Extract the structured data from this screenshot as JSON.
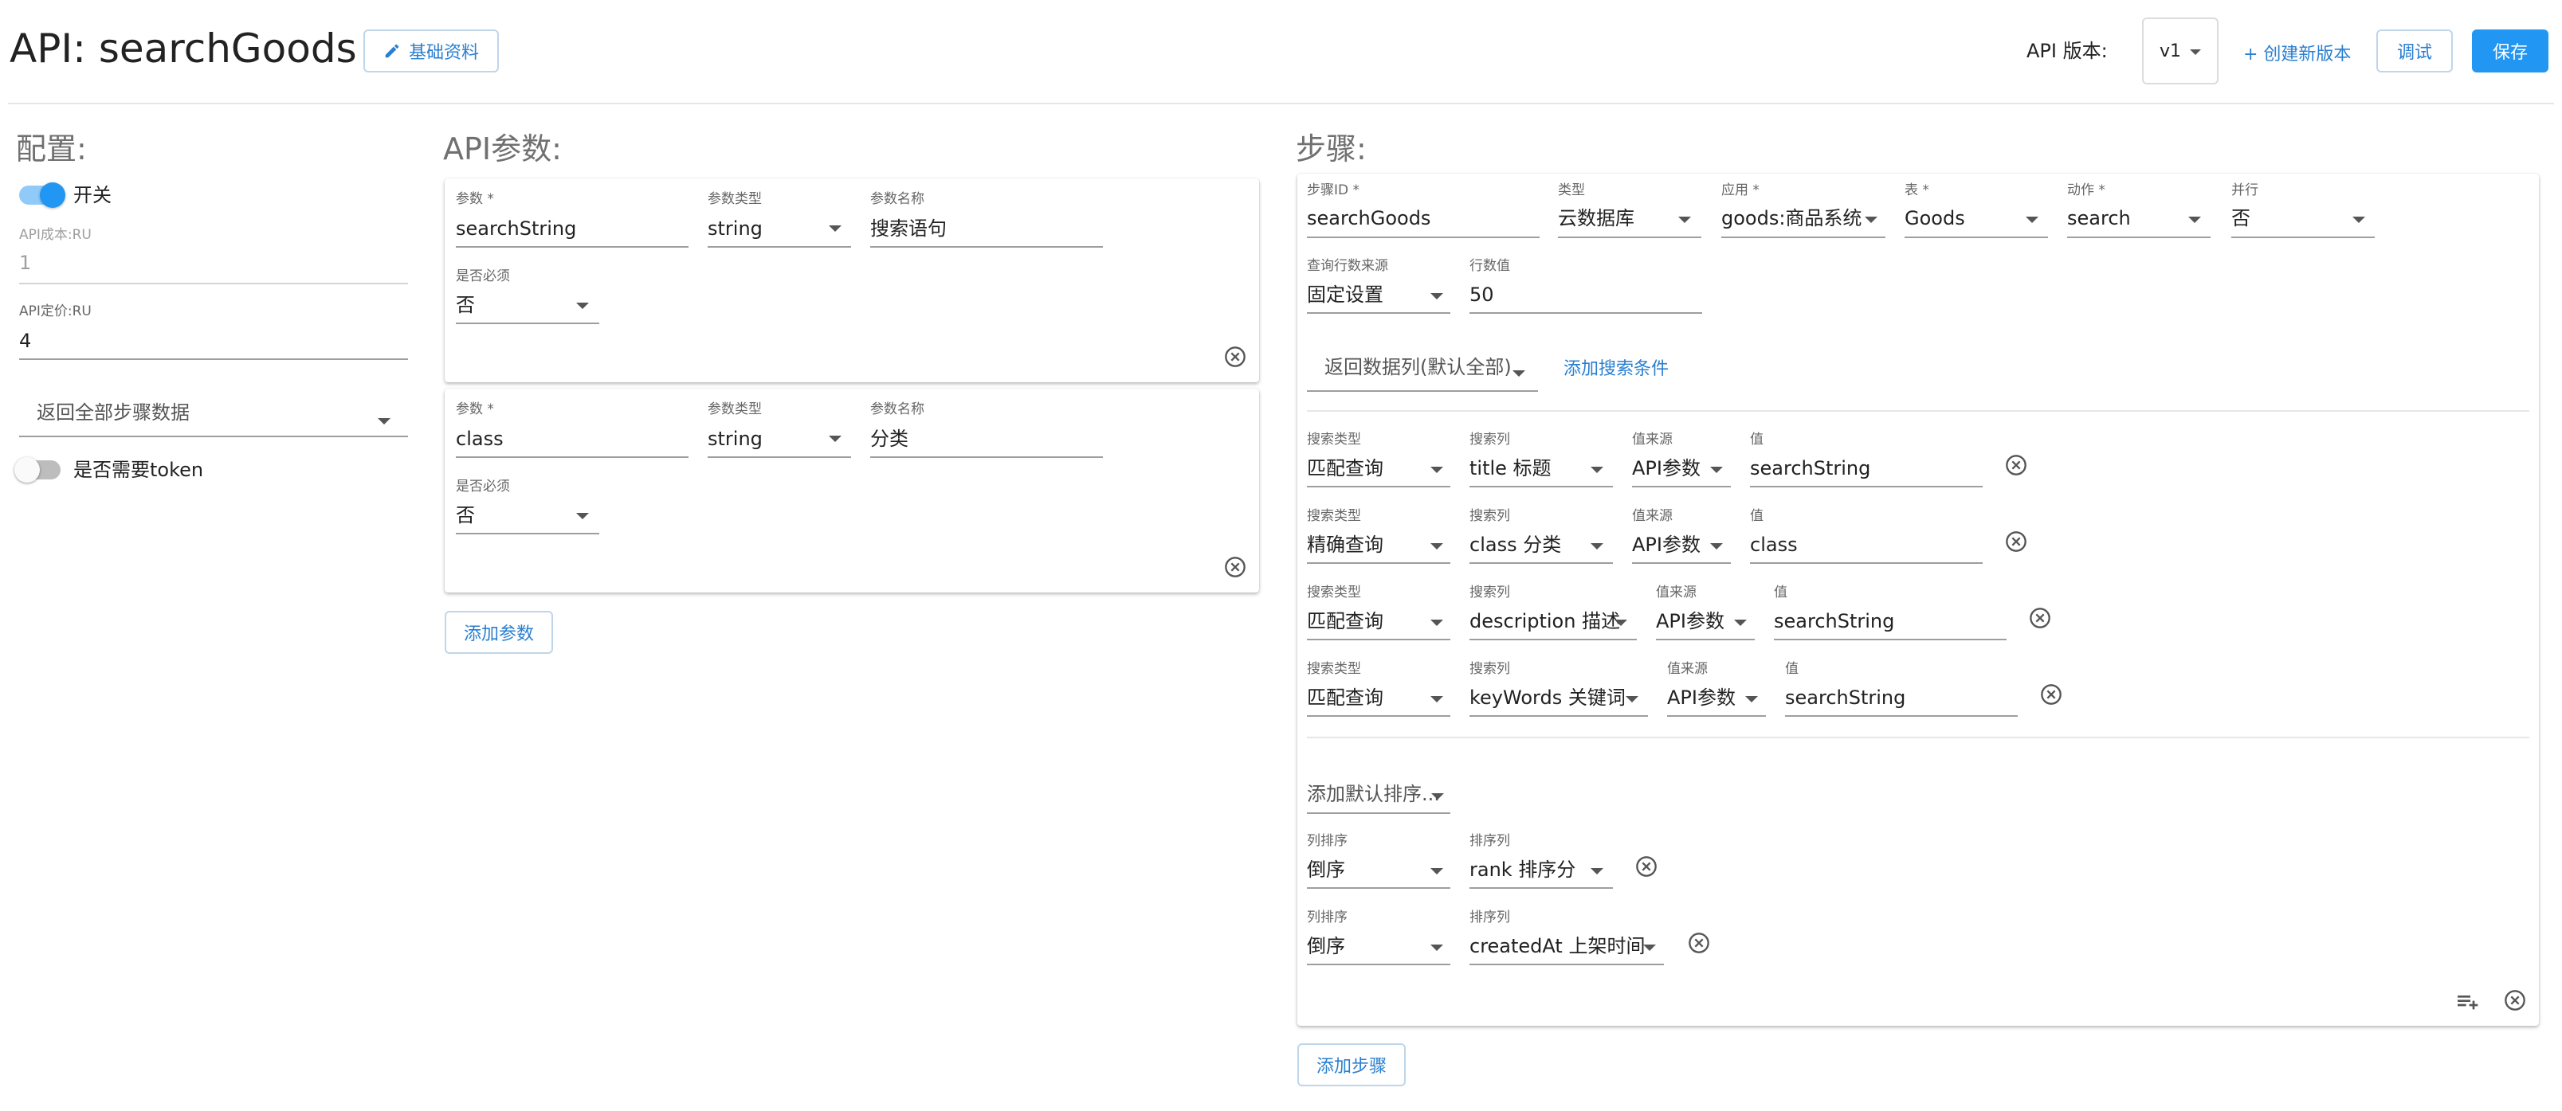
{
  "header": {
    "title": "API: searchGoods",
    "basic_info_label": "基础资料",
    "version_label": "API 版本:",
    "version_value": "v1",
    "create_version_label": "+ 创建新版本",
    "debug_label": "调试",
    "save_label": "保存"
  },
  "config": {
    "heading": "配置:",
    "switch_label": "开关",
    "cost_label": "API成本:RU",
    "cost_value": "1",
    "price_label": "API定价:RU",
    "price_value": "4",
    "return_select": "返回全部步骤数据",
    "token_label": "是否需要token"
  },
  "params": {
    "heading": "API参数:",
    "items": [
      {
        "param_label": "参数 *",
        "param_value": "searchString",
        "type_label": "参数类型",
        "type_value": "string",
        "name_label": "参数名称",
        "name_value": "搜索语句",
        "required_label": "是否必须",
        "required_value": "否"
      },
      {
        "param_label": "参数 *",
        "param_value": "class",
        "type_label": "参数类型",
        "type_value": "string",
        "name_label": "参数名称",
        "name_value": "分类",
        "required_label": "是否必须",
        "required_value": "否"
      }
    ],
    "add_label": "添加参数"
  },
  "steps": {
    "heading": "步骤:",
    "step_id_label": "步骤ID *",
    "step_id_value": "searchGoods",
    "type_label": "类型",
    "type_value": "云数据库",
    "app_label": "应用 *",
    "app_value": "goods:商品系统",
    "table_label": "表 *",
    "table_value": "Goods",
    "action_label": "动作 *",
    "action_value": "search",
    "parallel_label": "并行",
    "parallel_value": "否",
    "rows_source_label": "查询行数来源",
    "rows_source_value": "固定设置",
    "rows_value_label": "行数值",
    "rows_value": "50",
    "return_columns": "返回数据列(默认全部)",
    "add_condition_label": "添加搜索条件",
    "condition_labels": {
      "type": "搜索类型",
      "column": "搜索列",
      "source": "值来源",
      "value": "值"
    },
    "conditions": [
      {
        "type": "匹配查询",
        "column": "title 标题",
        "source": "API参数",
        "value": "searchString"
      },
      {
        "type": "精确查询",
        "column": "class 分类",
        "source": "API参数",
        "value": "class"
      },
      {
        "type": "匹配查询",
        "column": "description 描述",
        "source": "API参数",
        "value": "searchString"
      },
      {
        "type": "匹配查询",
        "column": "keyWords 关键词",
        "source": "API参数",
        "value": "searchString"
      }
    ],
    "add_sort_placeholder": "添加默认排序...",
    "sort_labels": {
      "order": "列排序",
      "column": "排序列"
    },
    "sorts": [
      {
        "order": "倒序",
        "column": "rank 排序分"
      },
      {
        "order": "倒序",
        "column": "createdAt 上架时间"
      }
    ],
    "add_step_label": "添加步骤"
  },
  "icons": {
    "edit": "pencil-icon",
    "remove": "close-circle-icon",
    "add_row": "playlist-add-icon",
    "dropdown": "caret-down-icon"
  },
  "colors": {
    "accent": "#2196f3",
    "link": "#2a7fd0",
    "toggle_on": "#2196f3",
    "toggle_off": "#9e9e9e"
  }
}
